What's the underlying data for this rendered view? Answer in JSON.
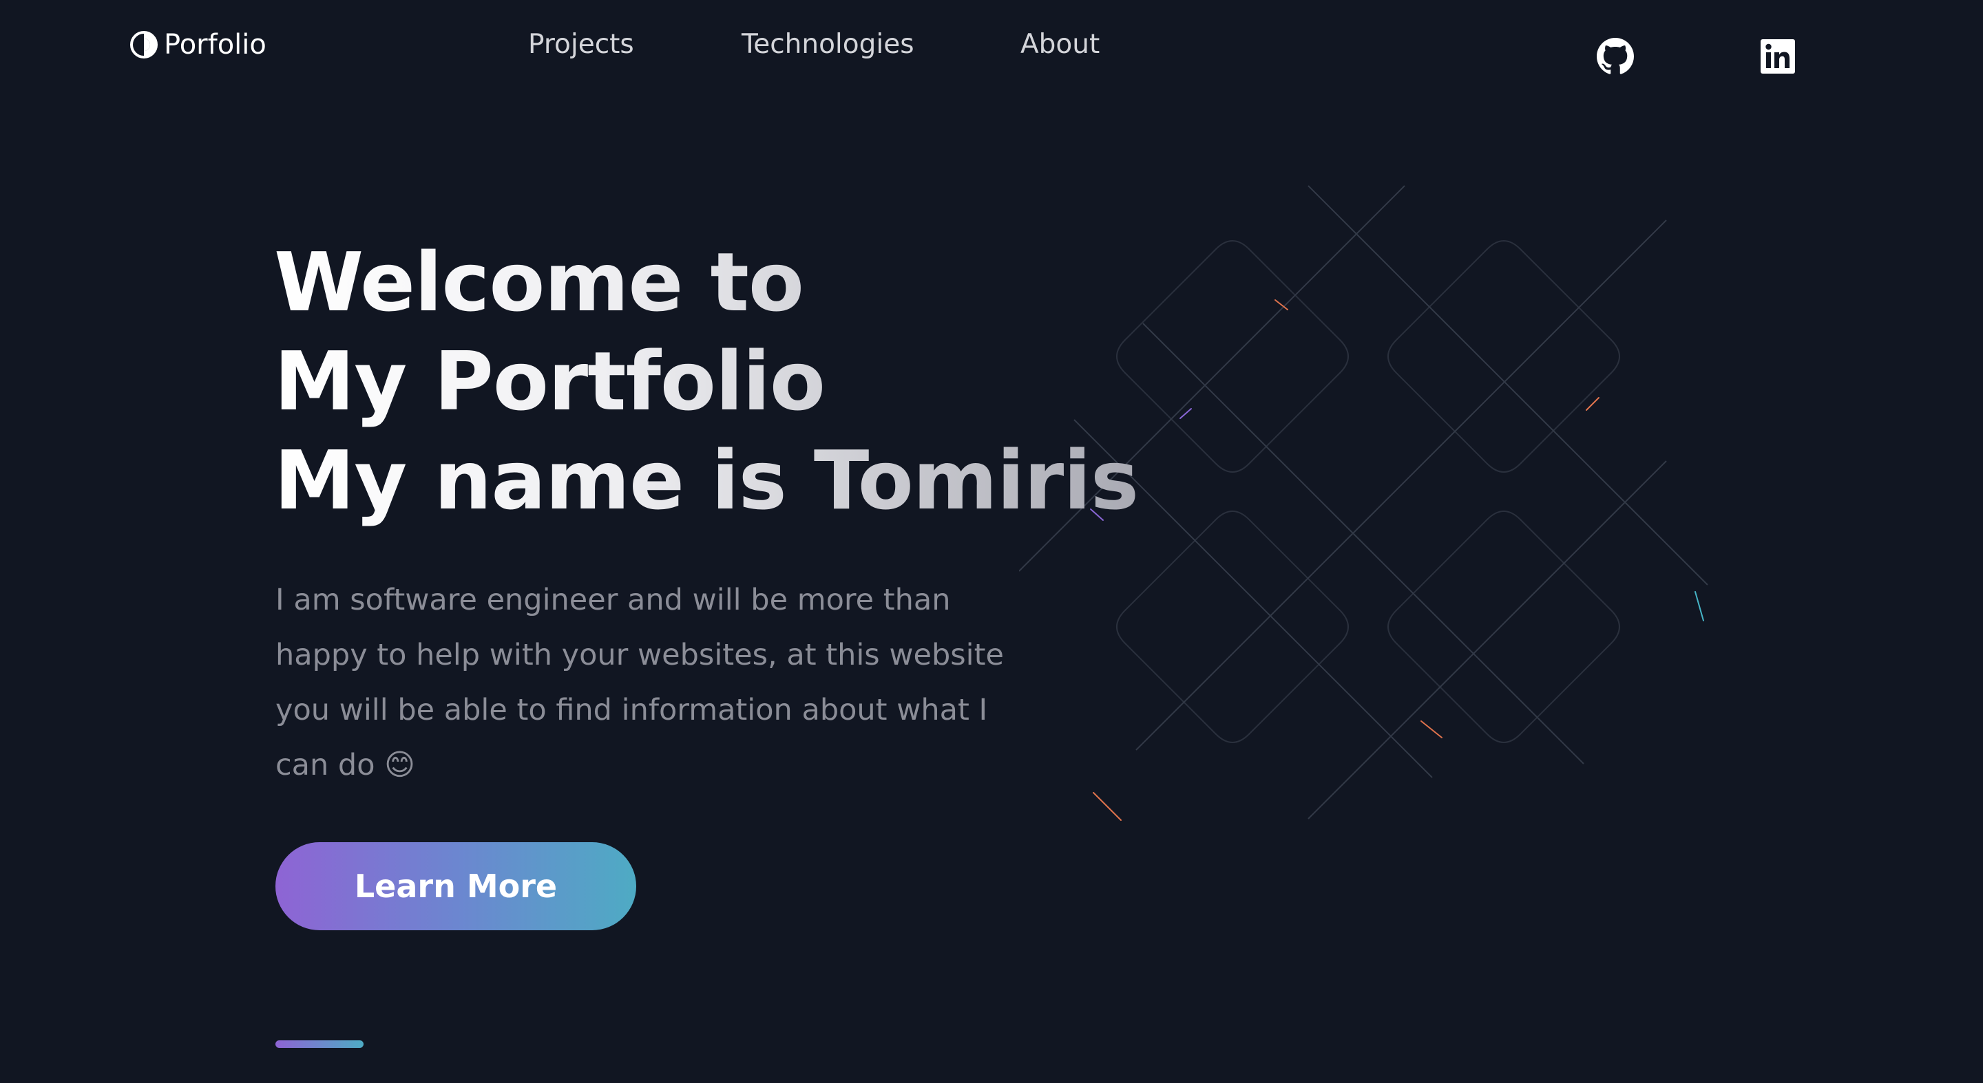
{
  "brand": {
    "name": "Porfolio",
    "icon": "half-circle-logo-icon"
  },
  "nav": {
    "links": [
      {
        "label": "Projects"
      },
      {
        "label": "Technologies"
      },
      {
        "label": "About"
      }
    ]
  },
  "social": [
    {
      "icon": "github-icon"
    },
    {
      "icon": "linkedin-icon"
    }
  ],
  "hero": {
    "title_lines": [
      "Welcome to",
      "My Portfolio",
      "My name is Tomiris"
    ],
    "description_lines": [
      "I am software engineer and will be more than",
      "happy to help with your websites, at this website",
      "you will be able to find information about what I",
      "can do 😊"
    ],
    "cta_label": "Learn More"
  },
  "colors": {
    "background": "#111622",
    "accent_start": "#8e64d4",
    "accent_end": "#4eabc4",
    "text_muted": "#8b8d97",
    "nav_text": "#d4d5da"
  }
}
